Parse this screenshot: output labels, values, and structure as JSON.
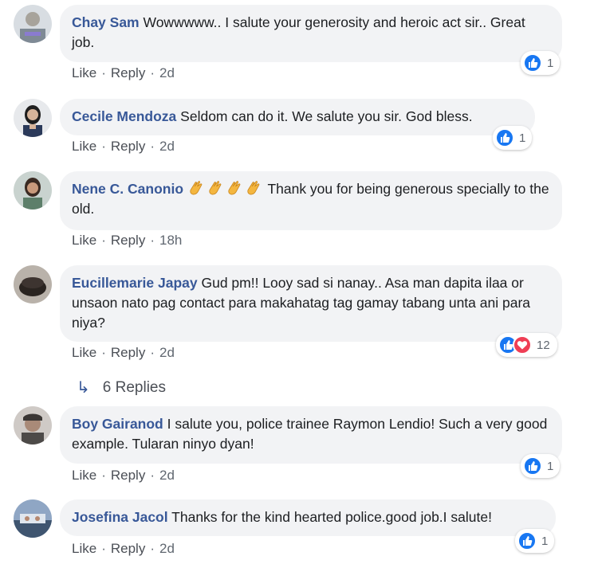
{
  "comments": [
    {
      "author": "Chay Sam",
      "text": "Wowwwww.. I salute your generosity and heroic act sir.. Great job.",
      "like": "Like",
      "reply": "Reply",
      "time": "2d",
      "reaction_count": "1",
      "avatar_icon": "profile-photo"
    },
    {
      "author": "Cecile Mendoza",
      "text": "Seldom can do it. We salute you sir. God bless.",
      "like": "Like",
      "reply": "Reply",
      "time": "2d",
      "reaction_count": "1",
      "avatar_icon": "profile-photo"
    },
    {
      "author": "Nene C. Canonio",
      "emoji": "clapping-hands-icon",
      "text": "Thank you for being generous specially to the old.",
      "like": "Like",
      "reply": "Reply",
      "time": "18h",
      "avatar_icon": "profile-photo"
    },
    {
      "author": "Eucillemarie Japay",
      "text": "Gud pm!! Looy sad si nanay.. Asa man dapita ilaa or unsaon nato pag contact para makahatag tag gamay tabang unta ani para niya?",
      "like": "Like",
      "reply": "Reply",
      "time": "2d",
      "reaction_count": "12",
      "avatar_icon": "profile-photo",
      "replies_label": "6 Replies"
    },
    {
      "author": "Boy Gairanod",
      "text": "I salute you, police trainee Raymon Lendio! Such a very good example. Tularan ninyo dyan!",
      "like": "Like",
      "reply": "Reply",
      "time": "2d",
      "reaction_count": "1",
      "avatar_icon": "profile-photo"
    },
    {
      "author": "Josefina Jacol",
      "text": "Thanks for the kind hearted police.good job.I salute!",
      "like": "Like",
      "reply": "Reply",
      "time": "2d",
      "reaction_count": "1",
      "avatar_icon": "profile-photo"
    }
  ],
  "colors": {
    "author": "#385898",
    "bubble": "#f2f3f5",
    "like_blue": "#1877f2",
    "love_red": "#ef3e55"
  }
}
